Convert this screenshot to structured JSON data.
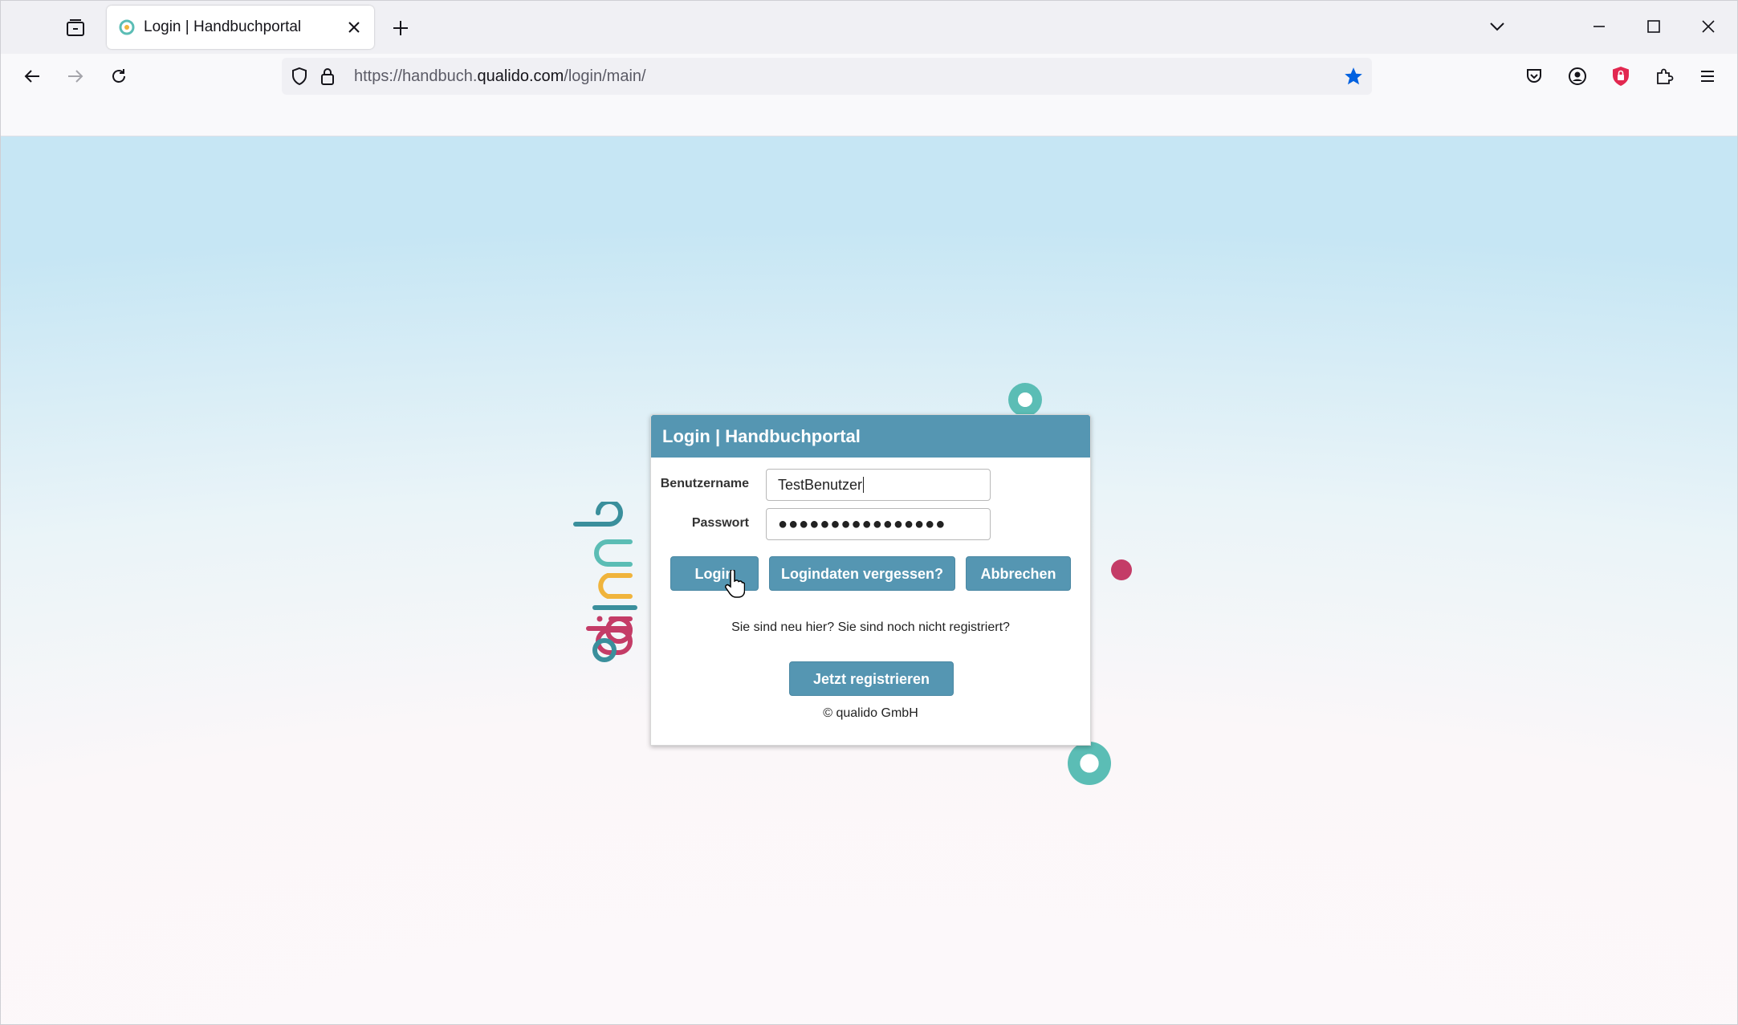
{
  "browser": {
    "tab": {
      "title": "Login | Handbuchportal"
    },
    "url": {
      "prefix": "https://handbuch.",
      "domain": "qualido.com",
      "path": "/login/main/"
    },
    "icons": {
      "tab_list": "tab-list-icon",
      "new_tab": "plus-icon",
      "close_tab": "close-icon",
      "overflow": "chevron-down-icon",
      "back": "arrow-left-icon",
      "forward": "arrow-right-icon",
      "reload": "reload-icon",
      "shield": "tracking-shield-icon",
      "lock": "lock-icon",
      "bookmark": "star-icon",
      "pocket": "pocket-icon",
      "account": "account-icon",
      "extension_shield": "red-shield-icon",
      "extensions": "puzzle-icon",
      "menu": "hamburger-icon"
    }
  },
  "login": {
    "title": "Login | Handbuchportal",
    "username_label": "Benutzername",
    "username_value": "TestBenutzer",
    "password_label": "Passwort",
    "password_value": "●●●●●●●●●●●●●●●●",
    "login_button": "Login",
    "forgot_button": "Logindaten vergessen?",
    "cancel_button": "Abbrechen",
    "new_here_text": "Sie sind neu hier? Sie sind noch nicht registriert?",
    "register_button": "Jetzt registrieren",
    "copyright": "© qualido GmbH"
  },
  "colors": {
    "accent": "#5596b2",
    "teal": "#5bbdb5",
    "crimson": "#c43c67",
    "bookmark_blue": "#0061e0",
    "shield_red": "#e22850"
  }
}
